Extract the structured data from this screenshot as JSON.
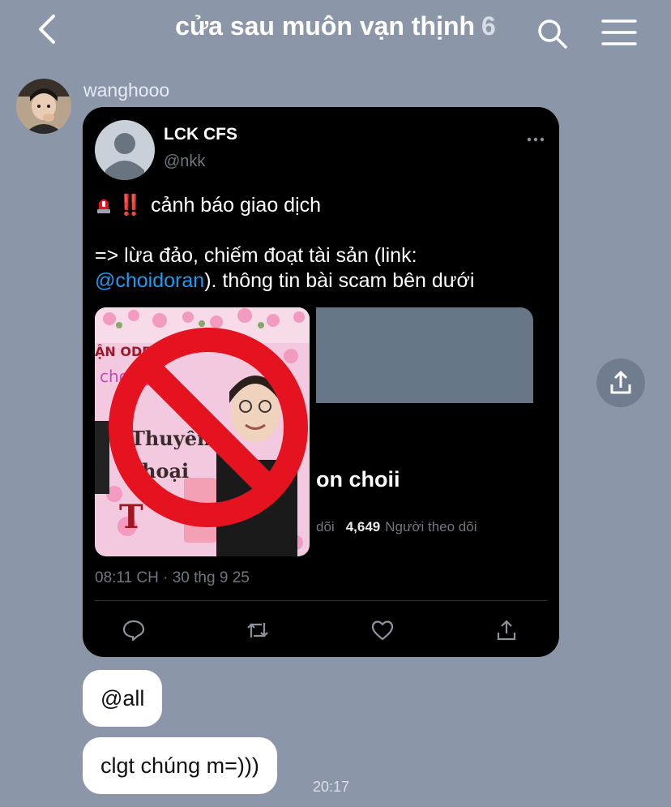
{
  "header": {
    "title": "cửa sau muôn vạn thịnh",
    "member_count": "6",
    "back_icon": "chevron-left-icon",
    "search_icon": "search-icon",
    "menu_icon": "hamburger-menu-icon"
  },
  "message": {
    "sender": "wanghooo",
    "tweet": {
      "author_name": "LCK CFS",
      "author_handle": "@nkk",
      "line1": "cảnh báo giao dịch",
      "line2": "=> lừa đảo, chiếm đoạt tài sản (link:",
      "mention": "@choidoran",
      "line3_rest": "). thông tin bài scam bên dưới",
      "emoji_bang": "‼️",
      "media_overlay_text": [
        "ẬN ODER",
        "chợ uyển",
        "Thuyền",
        "hoại"
      ],
      "embed_name": "on choii",
      "embed_following_suffix": "dõi",
      "embed_followers": "4,649",
      "embed_followers_label": "Người theo dõi",
      "timestamp": "08:11 CH · 30 thg 9 25"
    },
    "bubbles": [
      "@all",
      "clgt chúng m=)))"
    ],
    "time": "20:17"
  },
  "colors": {
    "background": "#8b97a8",
    "mention_blue": "#1d9bf0",
    "ban_red": "#e5121f"
  }
}
